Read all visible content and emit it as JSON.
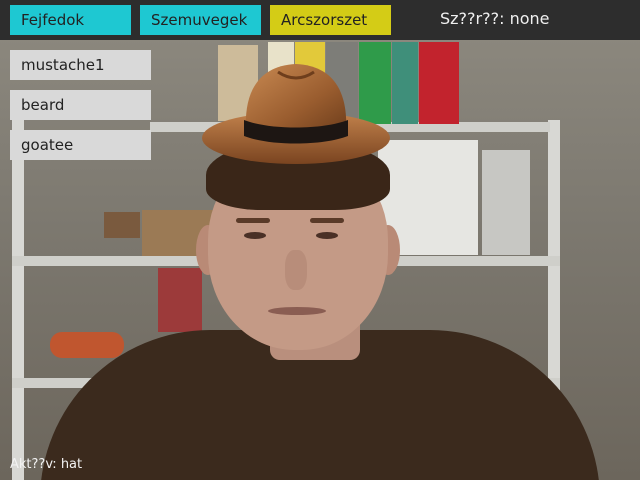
{
  "tabs": [
    {
      "label": "Fejfedok"
    },
    {
      "label": "Szemuvegek"
    },
    {
      "label": "Arcszorszet"
    }
  ],
  "filter_label": "Sz??r??: none",
  "side_items": [
    {
      "label": "mustache1"
    },
    {
      "label": "beard"
    },
    {
      "label": "goatee"
    }
  ],
  "status_label": "Akt??v: hat",
  "colors": {
    "tab_cyan": "#1ec8d2",
    "tab_yellow": "#d4cc16",
    "side_button": "#d9d9d9",
    "top_bar": "#2d2d2d"
  }
}
